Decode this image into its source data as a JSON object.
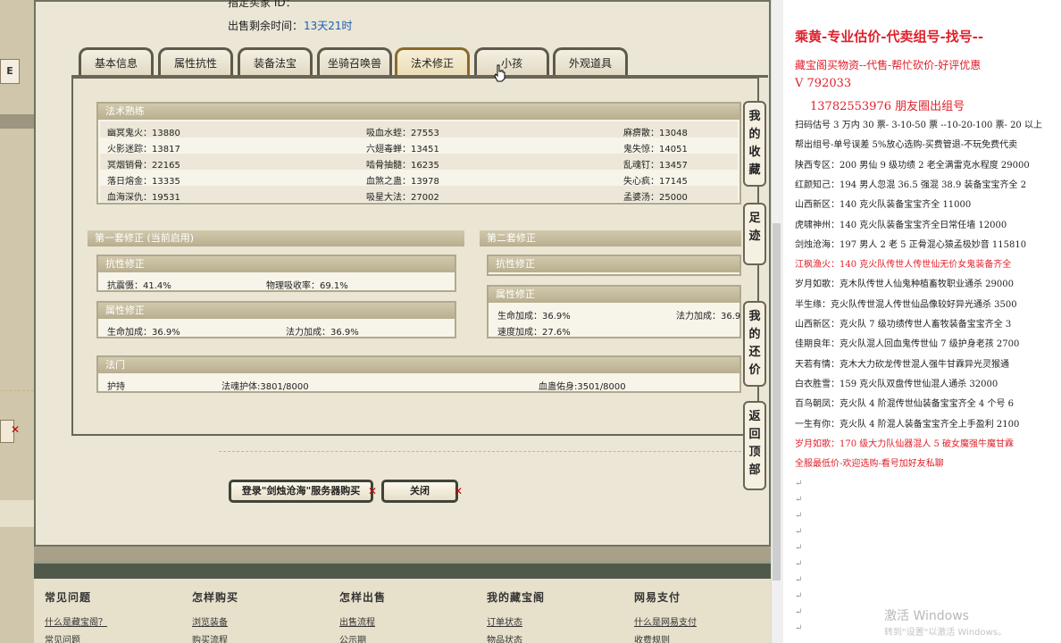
{
  "header": {
    "target_buyer_label": "指定买家 ID：",
    "sale_time_label": "出售剩余时间：",
    "sale_time_value": "13天21时"
  },
  "left_pane": {
    "tab_letter": "E"
  },
  "tabs": [
    {
      "label": "基本信息"
    },
    {
      "label": "属性抗性"
    },
    {
      "label": "装备法宝"
    },
    {
      "label": "坐骑召唤兽"
    },
    {
      "label": "法术修正",
      "active": true
    },
    {
      "label": "小孩"
    },
    {
      "label": "外观道具"
    }
  ],
  "spell_mastery": {
    "title": "法术熟练",
    "rows": [
      [
        "幽冥鬼火：13880",
        "吸血水蛭：27553",
        "麻痹散：13048"
      ],
      [
        "火影迷踪：13817",
        "六翅毒蝉：13451",
        "鬼失惊：14051"
      ],
      [
        "冥烟销骨：22165",
        "啮骨抽髓：16235",
        "乱魂钉：13457"
      ],
      [
        "落日熔金：13335",
        "血煞之蛊：13978",
        "失心疯：17145"
      ],
      [
        "血海深仇：19531",
        "吸星大法：27002",
        "孟婆汤：25000"
      ]
    ]
  },
  "set1": {
    "title": "第一套修正 (当前启用)",
    "resist_title": "抗性修正",
    "resist_values": [
      "抗震慑：41.4%",
      "物理吸收率：69.1%"
    ],
    "attr_title": "属性修正",
    "attr_values": [
      "生命加成：36.9%",
      "法力加成：36.9%"
    ]
  },
  "set2": {
    "title": "第二套修正",
    "resist_title": "抗性修正",
    "attr_title": "属性修正",
    "attr_values": [
      "生命加成：36.9%",
      "法力加成：36.9",
      "速度加成：27.6%"
    ]
  },
  "magic_gate": {
    "title": "法门",
    "values": [
      "护持",
      "法魂护体:3801/8000",
      "血蛊佑身:3501/8000"
    ]
  },
  "side_buttons": [
    "我的收藏",
    "足迹",
    "我的还价",
    "返回顶部"
  ],
  "buttons": {
    "login_server": "登录\"剑烛沧海\"服务器购买",
    "close": "关闭"
  },
  "footer": {
    "columns": [
      {
        "title": "常见问题",
        "links": [
          "什么是藏宝阁？",
          "常见问题"
        ]
      },
      {
        "title": "怎样购买",
        "links": [
          "浏览装备",
          "购买流程"
        ]
      },
      {
        "title": "怎样出售",
        "links": [
          "出售流程",
          "公示期"
        ]
      },
      {
        "title": "我的藏宝阁",
        "links": [
          "订单状态",
          "物品状态"
        ]
      },
      {
        "title": "网易支付",
        "links": [
          "什么是网易支付",
          "收费规则"
        ]
      }
    ]
  },
  "doc": {
    "title": "乘黄-专业估价-代卖组号-找号--",
    "line1": "藏宝阁买物资--代售-帮忙砍价-好评优惠",
    "vline": "V 792033",
    "phone": "13782553976 朋友圈出组号",
    "lines": [
      {
        "text": "扫码估号 3 万内 30 票- 3-10-50 票  --10-20-100 票- 20 以上",
        "red": false
      },
      {
        "text": "帮出组号-单号误差 5%放心选购-买费管退-不玩免费代卖",
        "red": false
      },
      {
        "text": "陕西专区：200 男仙 9 级功绩 2 老全满雷克水程度 29000",
        "red": false
      },
      {
        "text": "红颜知己：194 男人忽混 36.5 强混 38.9 装备宝宝齐全 2",
        "red": false
      },
      {
        "text": "山西新区：140 克火队装备宝宝齐全 11000",
        "red": false
      },
      {
        "text": "虎啸神州：140 克火队装备宝宝齐全日常任墙 12000",
        "red": false
      },
      {
        "text": "剑烛沧海：197 男人 2 老 5 正骨混心猿孟极妙音 115810",
        "red": false
      },
      {
        "text": "江枫渔火：140 克火队传世人传世仙无价女鬼装备齐全",
        "red": true
      },
      {
        "text": "岁月如歌：克木队传世人仙鬼种植畜牧职业通杀 29000",
        "red": false
      },
      {
        "text": "半生缘：克火队传世混人传世仙品像较好异光通杀 3500",
        "red": false
      },
      {
        "text": "山西新区：克火队 7 级功绩传世人畜牧装备宝宝齐全 3",
        "red": false
      },
      {
        "text": "佳期良年：克火队混人回血鬼传世仙 7 级护身老孩 2700",
        "red": false
      },
      {
        "text": "天若有情：克木大力砍龙传世混人强牛甘霖异光灵猴通",
        "red": false
      },
      {
        "text": "白衣胜雪：159 克火队双盘传世仙混人通杀 32000",
        "red": false
      },
      {
        "text": "百鸟朝凤：克火队 4 阶混传世仙装备宝宝齐全 4 个号 6",
        "red": false
      },
      {
        "text": "一生有你：克火队 4 阶混人装备宝宝齐全上手盈利 2100",
        "red": false
      },
      {
        "text": "岁月如歌：170 级大力队仙器混人 5 破女魔强牛魔甘霖",
        "red": true
      },
      {
        "text": "全服最低价-欢迎选购-看号加好友私聊",
        "red": true
      }
    ]
  },
  "watermark": {
    "line1": "激活 Windows",
    "line2": "转到\"设置\"以激活 Windows。"
  },
  "colors": {
    "accent_red": "#e0202a",
    "link_blue": "#1a5fb0",
    "frame": "#6a6656"
  }
}
